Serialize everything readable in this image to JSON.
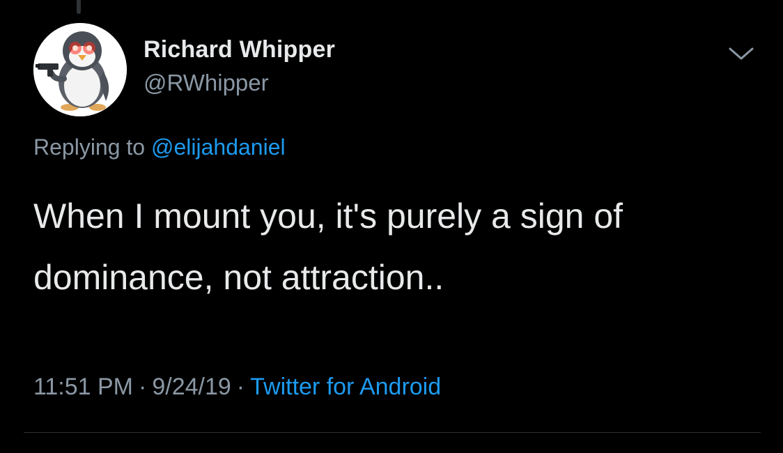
{
  "tweet": {
    "author": {
      "display_name": "Richard Whipper",
      "handle": "@RWhipper",
      "avatar": "penguin-with-gun-laser-eyes"
    },
    "reply_prefix": "Replying to",
    "reply_to": "@elijahdaniel",
    "text_line1": "When I mount you, it's purely a sign of",
    "text_line2": "dominance, not attraction..",
    "time": "11:51 PM",
    "separator": "·",
    "date": "9/24/19",
    "source": "Twitter for Android",
    "menu_icon": "chevron-down-icon"
  },
  "colors": {
    "background": "#000000",
    "text_primary": "#e7e9ea",
    "text_secondary": "#8b98a5",
    "link": "#1d9bf0",
    "divider": "#2f3336"
  }
}
